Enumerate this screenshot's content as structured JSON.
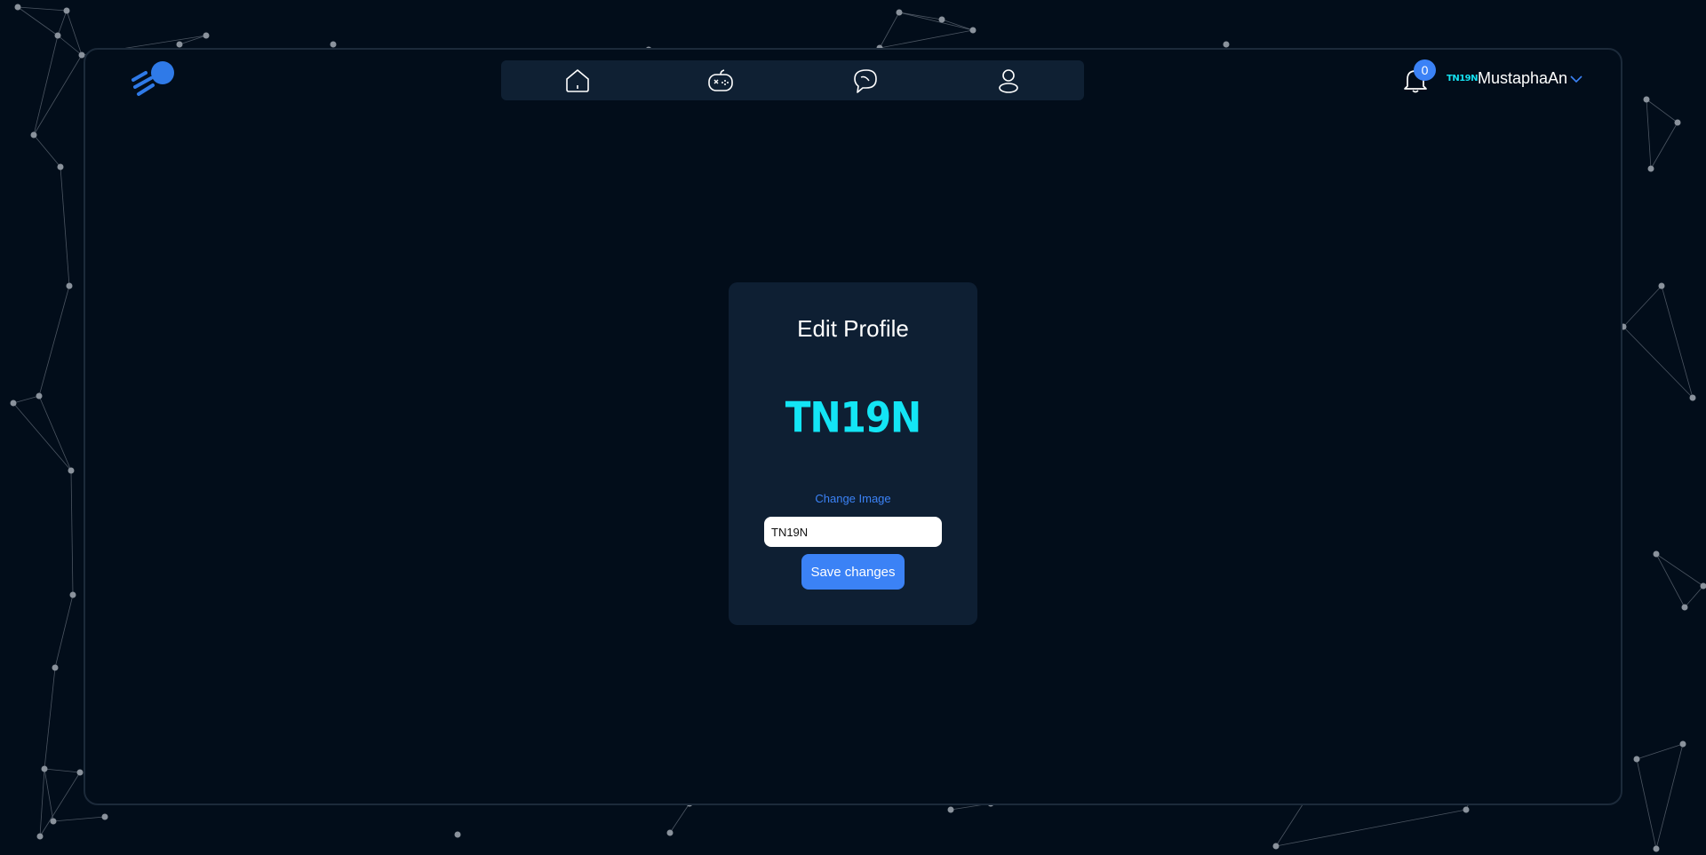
{
  "nav": {
    "items": [
      {
        "icon": "home-icon"
      },
      {
        "icon": "gamepad-icon"
      },
      {
        "icon": "chat-icon"
      },
      {
        "icon": "user-icon"
      }
    ]
  },
  "header": {
    "notifications_count": "0",
    "user_logo_text": "TN19N",
    "username": "MustaphaAn"
  },
  "edit_profile": {
    "title": "Edit Profile",
    "avatar_text": "TN19N",
    "change_image_label": "Change Image",
    "name_value": "TN19N",
    "save_label": "Save changes"
  },
  "colors": {
    "background": "#020d1a",
    "panel": "#0e1f33",
    "accent": "#3b82f6",
    "cyan": "#13e5f5"
  }
}
